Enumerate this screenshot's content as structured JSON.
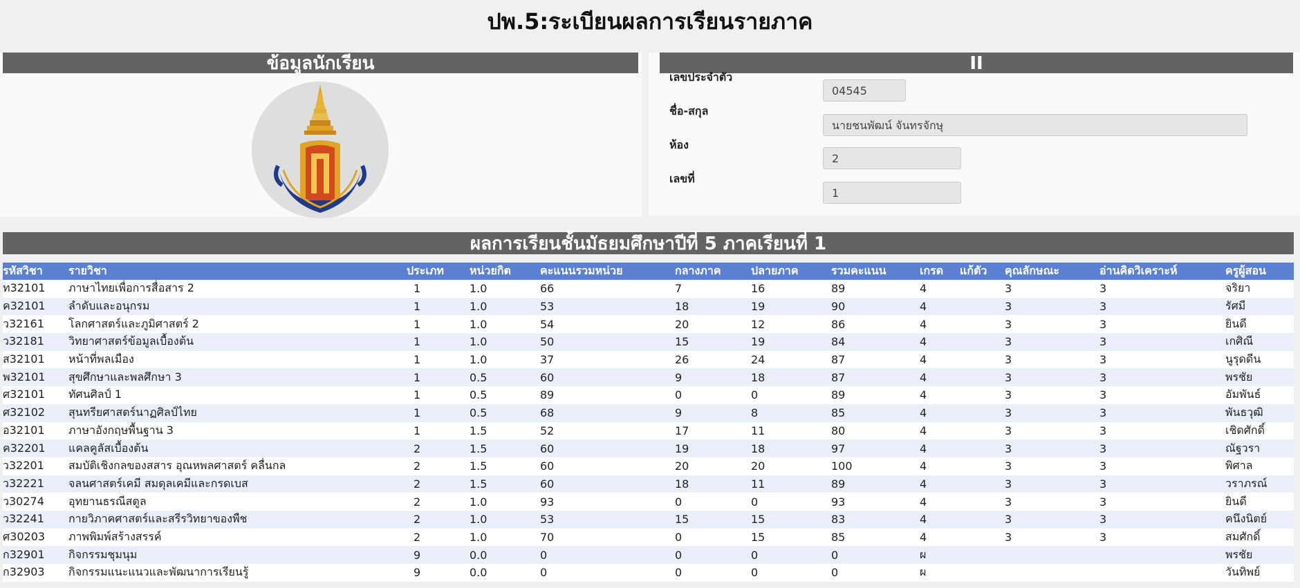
{
  "page_title": "ปพ.5:ระเบียนผลการเรียนรายภาค",
  "student_panel": {
    "heading": "ข้อมูลนักเรียน"
  },
  "detail_panel": {
    "heading": "II",
    "fields": [
      {
        "label": "เลขประจำตัว",
        "value": "04545"
      },
      {
        "label": "ชื่อ-สกุล",
        "value": "นายชนพัฒน์ จันทรจักษุ"
      },
      {
        "label": "ห้อง",
        "value": "2"
      },
      {
        "label": "เลขที่",
        "value": "1"
      }
    ]
  },
  "grades": {
    "heading": "ผลการเรียนชั้นมัธยมศึกษาปีที่ 5 ภาคเรียนที่ 1",
    "columns": [
      "รหัสวิชา",
      "รายวิชา",
      "ประเภท",
      "หน่วยกิต",
      "คะแนนรวมหน่วย",
      "กลางภาค",
      "ปลายภาค",
      "รวมคะแนน",
      "เกรด",
      "แก้ตัว",
      "คุณลักษณะ",
      "อ่านคิดวิเคราะห์",
      "ครูผู้สอน"
    ],
    "rows": [
      [
        "ท32101",
        "ภาษาไทยเพื่อการสื่อสาร 2",
        "1",
        "1.0",
        "66",
        "7",
        "16",
        "89",
        "4",
        "",
        "3",
        "3",
        "จริยา"
      ],
      [
        "ค32101",
        "ลำดับและอนุกรม",
        "1",
        "1.0",
        "53",
        "18",
        "19",
        "90",
        "4",
        "",
        "3",
        "3",
        "รัศมี"
      ],
      [
        "ว32161",
        "โลกศาสตร์และภูมิศาสตร์ 2",
        "1",
        "1.0",
        "54",
        "20",
        "12",
        "86",
        "4",
        "",
        "3",
        "3",
        "ยินดี"
      ],
      [
        "ว32181",
        "วิทยาศาสตร์ข้อมูลเบื้องต้น",
        "1",
        "1.0",
        "50",
        "15",
        "19",
        "84",
        "4",
        "",
        "3",
        "3",
        "เกศิณี"
      ],
      [
        "ส32101",
        "หน้าที่พลเมือง",
        "1",
        "1.0",
        "37",
        "26",
        "24",
        "87",
        "4",
        "",
        "3",
        "3",
        "นูรุดดีน"
      ],
      [
        "พ32101",
        "สุขศึกษาและพลศึกษา 3",
        "1",
        "0.5",
        "60",
        "9",
        "18",
        "87",
        "4",
        "",
        "3",
        "3",
        "พรชัย"
      ],
      [
        "ศ32101",
        "ทัศนศิลป์ 1",
        "1",
        "0.5",
        "89",
        "0",
        "0",
        "89",
        "4",
        "",
        "3",
        "3",
        "อัมพันธ์"
      ],
      [
        "ศ32102",
        "สุนทรียศาสตร์นาฏศิลป์ไทย",
        "1",
        "0.5",
        "68",
        "9",
        "8",
        "85",
        "4",
        "",
        "3",
        "3",
        "พันธวุฒิ"
      ],
      [
        "อ32101",
        "ภาษาอังกฤษพื้นฐาน 3",
        "1",
        "1.5",
        "52",
        "17",
        "11",
        "80",
        "4",
        "",
        "3",
        "3",
        "เชิดศักดิ์"
      ],
      [
        "ค32201",
        "แคลคูลัสเบื้องต้น",
        "2",
        "1.5",
        "60",
        "19",
        "18",
        "97",
        "4",
        "",
        "3",
        "3",
        "ณัฐวรา"
      ],
      [
        "ว32201",
        "สมบัติเชิงกลของสสาร อุณหพลศาสตร์ คลื่นกล",
        "2",
        "1.5",
        "60",
        "20",
        "20",
        "100",
        "4",
        "",
        "3",
        "3",
        "พิศาล"
      ],
      [
        "ว32221",
        "จลนศาสตร์เคมี สมดุลเคมีและกรดเบส",
        "2",
        "1.5",
        "60",
        "18",
        "11",
        "89",
        "4",
        "",
        "3",
        "3",
        "วราภรณ์"
      ],
      [
        "ว30274",
        "อุทยานธรณีสตูล",
        "2",
        "1.0",
        "93",
        "0",
        "0",
        "93",
        "4",
        "",
        "3",
        "3",
        "ยินดี"
      ],
      [
        "ว32241",
        "กายวิภาคศาสตร์และสรีรวิทยาของพืช",
        "2",
        "1.0",
        "53",
        "15",
        "15",
        "83",
        "4",
        "",
        "3",
        "3",
        "คนึงนิตย์"
      ],
      [
        "ศ30203",
        "ภาพพิมพ์สร้างสรรค์",
        "2",
        "1.0",
        "70",
        "0",
        "15",
        "85",
        "4",
        "",
        "3",
        "3",
        "สมศักดิ์"
      ],
      [
        "ก32901",
        "กิจกรรมชุมนุม",
        "9",
        "0.0",
        "0",
        "0",
        "0",
        "0",
        "ผ",
        "",
        "",
        "",
        "พรชัย"
      ],
      [
        "ก32903",
        "กิจกรรมแนะแนวและพัฒนาการเรียนรู้",
        "9",
        "0.0",
        "0",
        "0",
        "0",
        "0",
        "ผ",
        "",
        "",
        "",
        "วันทิพย์"
      ]
    ]
  },
  "logo": {
    "icon": "school-emblem-icon"
  },
  "colors": {
    "header_bar": "#636363",
    "table_header": "#5b80d3",
    "row_alt": "#e9eef9",
    "emblem_gold": "#e0a526",
    "emblem_navy": "#1f3a8a"
  }
}
